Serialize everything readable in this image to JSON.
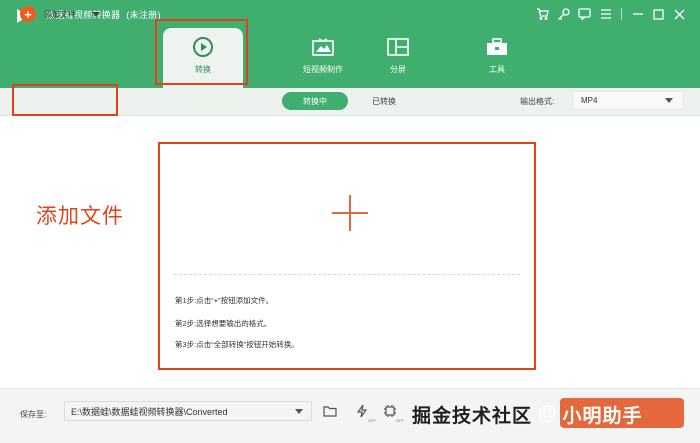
{
  "app": {
    "title": "数据蛙视频转换器",
    "registration_status": "(未注册)"
  },
  "window_controls": {
    "icons": [
      "cart-icon",
      "key-icon",
      "feedback-icon",
      "menu-icon",
      "minimize-icon",
      "maximize-icon",
      "close-icon"
    ]
  },
  "tabs": [
    {
      "label": "转换",
      "icon": "convert-icon",
      "active": true
    },
    {
      "label": "短视频制作",
      "icon": "short-video-icon",
      "active": false
    },
    {
      "label": "分屏",
      "icon": "split-screen-icon",
      "active": false
    },
    {
      "label": "工具",
      "icon": "toolbox-icon",
      "active": false
    }
  ],
  "toolbar": {
    "add_file_label": "添加文件",
    "segments": {
      "converting": "转换中",
      "converted": "已转换"
    },
    "output_format_label": "输出格式:",
    "output_format_value": "MP4"
  },
  "annotation": {
    "add_file_text": "添加文件"
  },
  "drop_area": {
    "steps": [
      "第1步:点击“+”按钮添加文件。",
      "第2步:选择想要输出的格式。",
      "第3步:点击“全部转换”按钮开始转换。"
    ]
  },
  "footer": {
    "save_to_label": "保存至:",
    "save_path": "E:\\数据蛙\\数据蛙视频转换器\\Converted",
    "off_badge": "OFF"
  },
  "watermark": {
    "site": "掘金技术社区",
    "at": "@",
    "user": "小明助手"
  },
  "colors": {
    "brand_green": "#3fae6f",
    "accent_orange": "#e4683b",
    "highlight_red": "#e2421b"
  }
}
